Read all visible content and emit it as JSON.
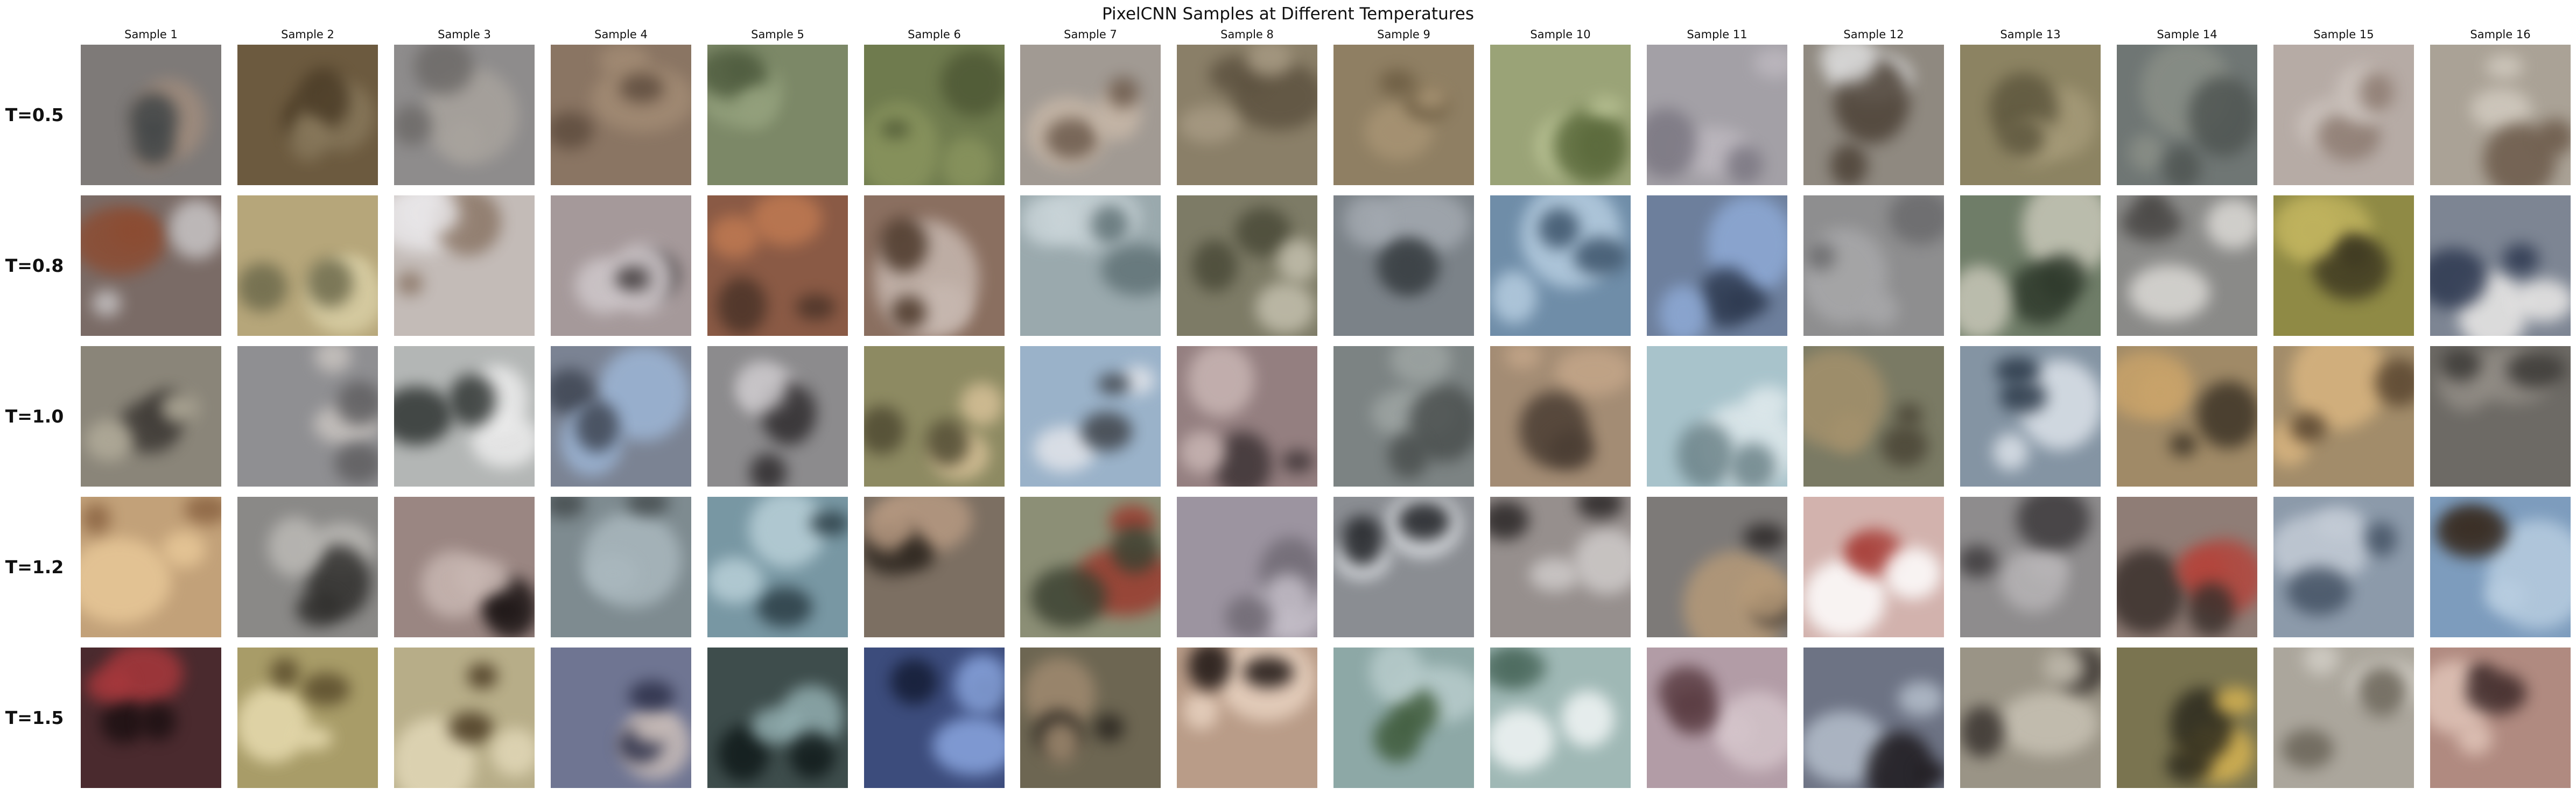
{
  "title": "PixelCNN Samples at Different Temperatures",
  "columns": [
    "Sample 1",
    "Sample 2",
    "Sample 3",
    "Sample 4",
    "Sample 5",
    "Sample 6",
    "Sample 7",
    "Sample 8",
    "Sample 9",
    "Sample 10",
    "Sample 11",
    "Sample 12",
    "Sample 13",
    "Sample 14",
    "Sample 15",
    "Sample 16"
  ],
  "rows": [
    "T=0.5",
    "T=0.8",
    "T=1.0",
    "T=1.2",
    "T=1.5"
  ],
  "tile_colors": [
    [
      {
        "bg": "#7e7a78",
        "a": "#a08c7d",
        "b": "#3f4446"
      },
      {
        "bg": "#6c5a3f",
        "a": "#4a3b26",
        "b": "#8a7a5d"
      },
      {
        "bg": "#8e8c8c",
        "a": "#a8a39d",
        "b": "#6d6a68"
      },
      {
        "bg": "#8a7563",
        "a": "#a28b74",
        "b": "#5e4c3e"
      },
      {
        "bg": "#7c8867",
        "a": "#93a07c",
        "b": "#4f5c3f"
      },
      {
        "bg": "#6f7b4e",
        "a": "#89945e",
        "b": "#4e5835"
      },
      {
        "bg": "#a19a93",
        "a": "#c8b8a8",
        "b": "#6c5a4c"
      },
      {
        "bg": "#8a7f68",
        "a": "#5d5240",
        "b": "#a89b84"
      },
      {
        "bg": "#8f7f63",
        "a": "#a89474",
        "b": "#6c5c42"
      },
      {
        "bg": "#9aa377",
        "a": "#b9c294",
        "b": "#5b6a3c"
      },
      {
        "bg": "#a3a0a6",
        "a": "#bdb8bf",
        "b": "#7b7782"
      },
      {
        "bg": "#8f8980",
        "a": "#dcdcdc",
        "b": "#4c4136"
      },
      {
        "bg": "#8c8362",
        "a": "#a59a78",
        "b": "#5e573e"
      },
      {
        "bg": "#6f7674",
        "a": "#8a8f87",
        "b": "#4f5552"
      },
      {
        "bg": "#b6aba5",
        "a": "#cbc2bc",
        "b": "#8c7a70"
      },
      {
        "bg": "#aaa296",
        "a": "#d2cbc0",
        "b": "#6c5a4a"
      }
    ],
    [
      {
        "bg": "#7a6b66",
        "a": "#8c4c32",
        "b": "#c8c5c6"
      },
      {
        "bg": "#b6a67a",
        "a": "#d9cfa5",
        "b": "#6d6a4c"
      },
      {
        "bg": "#c3bbb7",
        "a": "#e8e6e8",
        "b": "#8a7565"
      },
      {
        "bg": "#a5999a",
        "a": "#cfc8cb",
        "b": "#3f393a"
      },
      {
        "bg": "#8a5a45",
        "a": "#c07a52",
        "b": "#4a3328"
      },
      {
        "bg": "#8a6f60",
        "a": "#c7b8b0",
        "b": "#4a3628"
      },
      {
        "bg": "#9aa9ad",
        "a": "#c9d4d8",
        "b": "#607276"
      },
      {
        "bg": "#7d7b66",
        "a": "#c4c0ae",
        "b": "#4a4a38"
      },
      {
        "bg": "#7b8288",
        "a": "#a3a9b0",
        "b": "#3d4347"
      },
      {
        "bg": "#6f8da8",
        "a": "#b6cde0",
        "b": "#3c536a"
      },
      {
        "bg": "#6d7f9c",
        "a": "#8eaad6",
        "b": "#2e3a50"
      },
      {
        "bg": "#8e8e8f",
        "a": "#a8a8aa",
        "b": "#6a6a6c"
      },
      {
        "bg": "#6f7d68",
        "a": "#c8c7b8",
        "b": "#2f3a2c"
      },
      {
        "bg": "#8a8a88",
        "a": "#dcdad6",
        "b": "#4a4846"
      },
      {
        "bg": "#8f8a45",
        "a": "#c0b35e",
        "b": "#3f3a22"
      },
      {
        "bg": "#7d8593",
        "a": "#eceae8",
        "b": "#2d3850"
      }
    ],
    [
      {
        "bg": "#8a8579",
        "a": "#3c3834",
        "b": "#b2ac9a"
      },
      {
        "bg": "#8f8f92",
        "a": "#c9c4c0",
        "b": "#5f5e60"
      },
      {
        "bg": "#b3b6b5",
        "a": "#ececec",
        "b": "#2f3432"
      },
      {
        "bg": "#7b8393",
        "a": "#9db6d6",
        "b": "#3e4552"
      },
      {
        "bg": "#8c8b8d",
        "a": "#c9c6c9",
        "b": "#2e2b2d"
      },
      {
        "bg": "#8d8a62",
        "a": "#d7c198",
        "b": "#4f4a32"
      },
      {
        "bg": "#9ab2c9",
        "a": "#e3e5ea",
        "b": "#3f4349"
      },
      {
        "bg": "#947f80",
        "a": "#c9b6b4",
        "b": "#3d3335"
      },
      {
        "bg": "#7c8383",
        "a": "#9ea5a3",
        "b": "#4a4f4e"
      },
      {
        "bg": "#a38c74",
        "a": "#c4a689",
        "b": "#4a3d33"
      },
      {
        "bg": "#a8c3cb",
        "a": "#dfe9ec",
        "b": "#6c8389"
      },
      {
        "bg": "#7a7a64",
        "a": "#a4916c",
        "b": "#4a4536"
      },
      {
        "bg": "#8494a3",
        "a": "#dde3ea",
        "b": "#2a3848"
      },
      {
        "bg": "#a08a67",
        "a": "#c9a36a",
        "b": "#3d3427"
      },
      {
        "bg": "#a28c6a",
        "a": "#d9b580",
        "b": "#5a4630"
      },
      {
        "bg": "#6d6a65",
        "a": "#928d86",
        "b": "#3a3835"
      }
    ],
    [
      {
        "bg": "#c2a179",
        "a": "#e8c898",
        "b": "#8a6342"
      },
      {
        "bg": "#8a8987",
        "a": "#bcbab6",
        "b": "#2f2e2c"
      },
      {
        "bg": "#9a8682",
        "a": "#c8b7b2",
        "b": "#1d1616"
      },
      {
        "bg": "#7e8b90",
        "a": "#aab8be",
        "b": "#454c4e"
      },
      {
        "bg": "#7897a3",
        "a": "#b9d0d8",
        "b": "#2a3c44"
      },
      {
        "bg": "#7c6f62",
        "a": "#b79a82",
        "b": "#2e2720"
      },
      {
        "bg": "#8c8f76",
        "a": "#9a3a2e",
        "b": "#3c4232"
      },
      {
        "bg": "#9c94a0",
        "a": "#c4bec8",
        "b": "#706a74"
      },
      {
        "bg": "#8a8d92",
        "a": "#dfe2e6",
        "b": "#1c1e22"
      },
      {
        "bg": "#968f8d",
        "a": "#cfcbca",
        "b": "#2a2626"
      },
      {
        "bg": "#7d7a78",
        "a": "#b69a78",
        "b": "#2a2626"
      },
      {
        "bg": "#d2b2ad",
        "a": "#ffffff",
        "b": "#a8403a"
      },
      {
        "bg": "#8e8c8d",
        "a": "#b7b4b6",
        "b": "#3d3a3c"
      },
      {
        "bg": "#8f7d76",
        "a": "#b3453c",
        "b": "#3a302c"
      },
      {
        "bg": "#8c9aaa",
        "a": "#c4ccd6",
        "b": "#445264"
      },
      {
        "bg": "#7d9cbd",
        "a": "#b8cde0",
        "b": "#3a2e24"
      }
    ],
    [
      {
        "bg": "#4a2a2e",
        "a": "#a8383c",
        "b": "#1c1012"
      },
      {
        "bg": "#a89c68",
        "a": "#e8dcb0",
        "b": "#5a4c2c"
      },
      {
        "bg": "#b7ad88",
        "a": "#e2d8b8",
        "b": "#4a3a22"
      },
      {
        "bg": "#6f7592",
        "a": "#c8bcb8",
        "b": "#2c2f48"
      },
      {
        "bg": "#3e4d4c",
        "a": "#92aeb0",
        "b": "#101a1a"
      },
      {
        "bg": "#3c4c7c",
        "a": "#8aa6e0",
        "b": "#141c34"
      },
      {
        "bg": "#6d6652",
        "a": "#a08a70",
        "b": "#2a2620"
      },
      {
        "bg": "#b99c88",
        "a": "#e8d2c0",
        "b": "#1c1412"
      },
      {
        "bg": "#8da8a6",
        "a": "#b8cccc",
        "b": "#3e5a3a"
      },
      {
        "bg": "#9fb8b5",
        "a": "#f2f6f6",
        "b": "#4c6a5e"
      },
      {
        "bg": "#b29ca6",
        "a": "#d4c4ca",
        "b": "#5a3c42"
      },
      {
        "bg": "#6d7384",
        "a": "#b5bfcc",
        "b": "#1e1a1e"
      },
      {
        "bg": "#9a9486",
        "a": "#c8c2b4",
        "b": "#3a3430"
      },
      {
        "bg": "#7a7450",
        "a": "#d7b452",
        "b": "#2c2a1e"
      },
      {
        "bg": "#aba69c",
        "a": "#d2cec6",
        "b": "#6a6458"
      },
      {
        "bg": "#b08a80",
        "a": "#e0c4b8",
        "b": "#3c2828"
      }
    ]
  ]
}
